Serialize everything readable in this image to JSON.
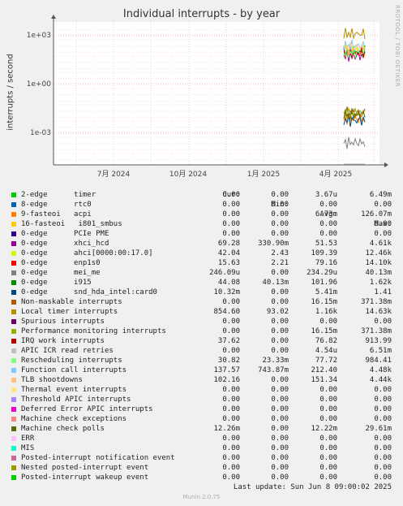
{
  "chart_data": {
    "type": "line",
    "title": "Individual interrupts - by year",
    "ylabel": "interrupts / second",
    "yscale": "log",
    "y_ticks": [
      "1e+03",
      "1e+00",
      "1e-03"
    ],
    "x_ticks": [
      "7月 2024",
      "10月 2024",
      "1月 2025",
      "4月 2025"
    ],
    "grid": true,
    "columns": [
      "Cur:",
      "Min:",
      "Avg:",
      "Max:"
    ],
    "series": [
      {
        "name": "2-edge      timer",
        "color": "#00cc00",
        "cur": "0.00",
        "min": "0.00",
        "avg": "3.67u",
        "max": "6.49m"
      },
      {
        "name": "8-edge      rtc0",
        "color": "#0066b3",
        "cur": "0.00",
        "min": "0.00",
        "avg": "0.00",
        "max": "0.00"
      },
      {
        "name": "9-fasteoi   acpi",
        "color": "#ff8000",
        "cur": "0.00",
        "min": "0.00",
        "avg": "6.73m",
        "max": "126.07m"
      },
      {
        "name": "16-fasteoi   i801_smbus",
        "color": "#ffcc00",
        "cur": "0.00",
        "min": "0.00",
        "avg": "0.00",
        "max": "0.00"
      },
      {
        "name": "0-edge      PCIe PME",
        "color": "#330099",
        "cur": "0.00",
        "min": "0.00",
        "avg": "0.00",
        "max": "0.00"
      },
      {
        "name": "0-edge      xhci_hcd",
        "color": "#990099",
        "cur": "69.28",
        "min": "330.90m",
        "avg": "51.53",
        "max": "4.61k"
      },
      {
        "name": "0-edge      ahci[0000:00:17.0]",
        "color": "#ccff00",
        "cur": "42.04",
        "min": "2.43",
        "avg": "109.39",
        "max": "12.46k"
      },
      {
        "name": "0-edge      enp1s0",
        "color": "#ff0000",
        "cur": "15.63",
        "min": "2.21",
        "avg": "79.16",
        "max": "14.10k"
      },
      {
        "name": "0-edge      mei_me",
        "color": "#808080",
        "cur": "246.09u",
        "min": "0.00",
        "avg": "234.29u",
        "max": "40.13m"
      },
      {
        "name": "0-edge      i915",
        "color": "#008f00",
        "cur": "44.08",
        "min": "40.13m",
        "avg": "101.96",
        "max": "1.62k"
      },
      {
        "name": "0-edge      snd_hda_intel:card0",
        "color": "#00487d",
        "cur": "10.32m",
        "min": "0.00",
        "avg": "5.41m",
        "max": "1.41"
      },
      {
        "name": "Non-maskable interrupts",
        "color": "#b35a00",
        "cur": "0.00",
        "min": "0.00",
        "avg": "16.15m",
        "max": "371.38m"
      },
      {
        "name": "Local timer interrupts",
        "color": "#b38f00",
        "cur": "854.60",
        "min": "93.02",
        "avg": "1.16k",
        "max": "14.63k"
      },
      {
        "name": "Spurious interrupts",
        "color": "#6b006b",
        "cur": "0.00",
        "min": "0.00",
        "avg": "0.00",
        "max": "0.00"
      },
      {
        "name": "Performance monitoring interrupts",
        "color": "#8fb300",
        "cur": "0.00",
        "min": "0.00",
        "avg": "16.15m",
        "max": "371.38m"
      },
      {
        "name": "IRQ work interrupts",
        "color": "#b30000",
        "cur": "37.62",
        "min": "0.00",
        "avg": "76.82",
        "max": "913.99"
      },
      {
        "name": "APIC ICR read retries",
        "color": "#bebebe",
        "cur": "0.00",
        "min": "0.00",
        "avg": "4.54u",
        "max": "6.51m"
      },
      {
        "name": "Rescheduling interrupts",
        "color": "#80ff80",
        "cur": "30.82",
        "min": "23.33m",
        "avg": "77.72",
        "max": "984.41"
      },
      {
        "name": "Function call interrupts",
        "color": "#80c9ff",
        "cur": "137.57",
        "min": "743.87m",
        "avg": "212.40",
        "max": "4.48k"
      },
      {
        "name": "TLB shootdowns",
        "color": "#ffc080",
        "cur": "102.16",
        "min": "0.00",
        "avg": "151.34",
        "max": "4.44k"
      },
      {
        "name": "Thermal event interrupts",
        "color": "#ffe680",
        "cur": "0.00",
        "min": "0.00",
        "avg": "0.00",
        "max": "0.00"
      },
      {
        "name": "Threshold APIC interrupts",
        "color": "#aa80ff",
        "cur": "0.00",
        "min": "0.00",
        "avg": "0.00",
        "max": "0.00"
      },
      {
        "name": "Deferred Error APIC interrupts",
        "color": "#ee00cc",
        "cur": "0.00",
        "min": "0.00",
        "avg": "0.00",
        "max": "0.00"
      },
      {
        "name": "Machine check exceptions",
        "color": "#ff8080",
        "cur": "0.00",
        "min": "0.00",
        "avg": "0.00",
        "max": "0.00"
      },
      {
        "name": "Machine check polls",
        "color": "#666600",
        "cur": "12.26m",
        "min": "0.00",
        "avg": "12.22m",
        "max": "29.61m"
      },
      {
        "name": "ERR",
        "color": "#ffbfff",
        "cur": "0.00",
        "min": "0.00",
        "avg": "0.00",
        "max": "0.00"
      },
      {
        "name": "MIS",
        "color": "#00ffcc",
        "cur": "0.00",
        "min": "0.00",
        "avg": "0.00",
        "max": "0.00"
      },
      {
        "name": "Posted-interrupt notification event",
        "color": "#cc6699",
        "cur": "0.00",
        "min": "0.00",
        "avg": "0.00",
        "max": "0.00"
      },
      {
        "name": "Nested posted-interrupt event",
        "color": "#999900",
        "cur": "0.00",
        "min": "0.00",
        "avg": "0.00",
        "max": "0.00"
      },
      {
        "name": "Posted-interrupt wakeup event",
        "color": "#00cc00",
        "cur": "0.00",
        "min": "0.00",
        "avg": "0.00",
        "max": "0.00"
      }
    ]
  },
  "side_text": "RRDTOOL / TOBI OETIKER",
  "last_update": "Last update: Sun Jun  8 09:00:02 2025",
  "footer": "Munin 2.0.75"
}
